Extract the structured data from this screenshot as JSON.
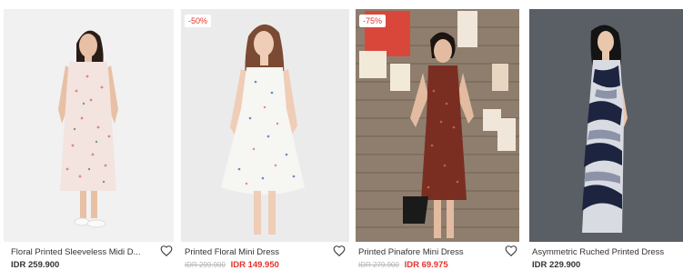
{
  "products": [
    {
      "name": "Floral Printed Sleeveless Midi D...",
      "price": "IDR 259.900",
      "badge": "",
      "original_price": "",
      "sale_price": "",
      "wishlist_icon": "heart-outline-icon"
    },
    {
      "name": "Printed Floral Mini Dress",
      "price": "",
      "badge": "-50%",
      "original_price": "IDR 299.900",
      "sale_price": "IDR 149.950",
      "wishlist_icon": "heart-outline-icon"
    },
    {
      "name": "Printed Pinafore Mini Dress",
      "price": "",
      "badge": "-75%",
      "original_price": "IDR 279.900",
      "sale_price": "IDR 69.975",
      "wishlist_icon": "heart-outline-icon"
    },
    {
      "name": "Asymmetric Ruched Printed Dress",
      "price": "IDR 229.900",
      "badge": "",
      "original_price": "",
      "sale_price": "",
      "wishlist_icon": "heart-outline-icon"
    }
  ],
  "colors": {
    "sale": "#e5322d",
    "strike": "#b5b5b5",
    "text": "#333333"
  }
}
